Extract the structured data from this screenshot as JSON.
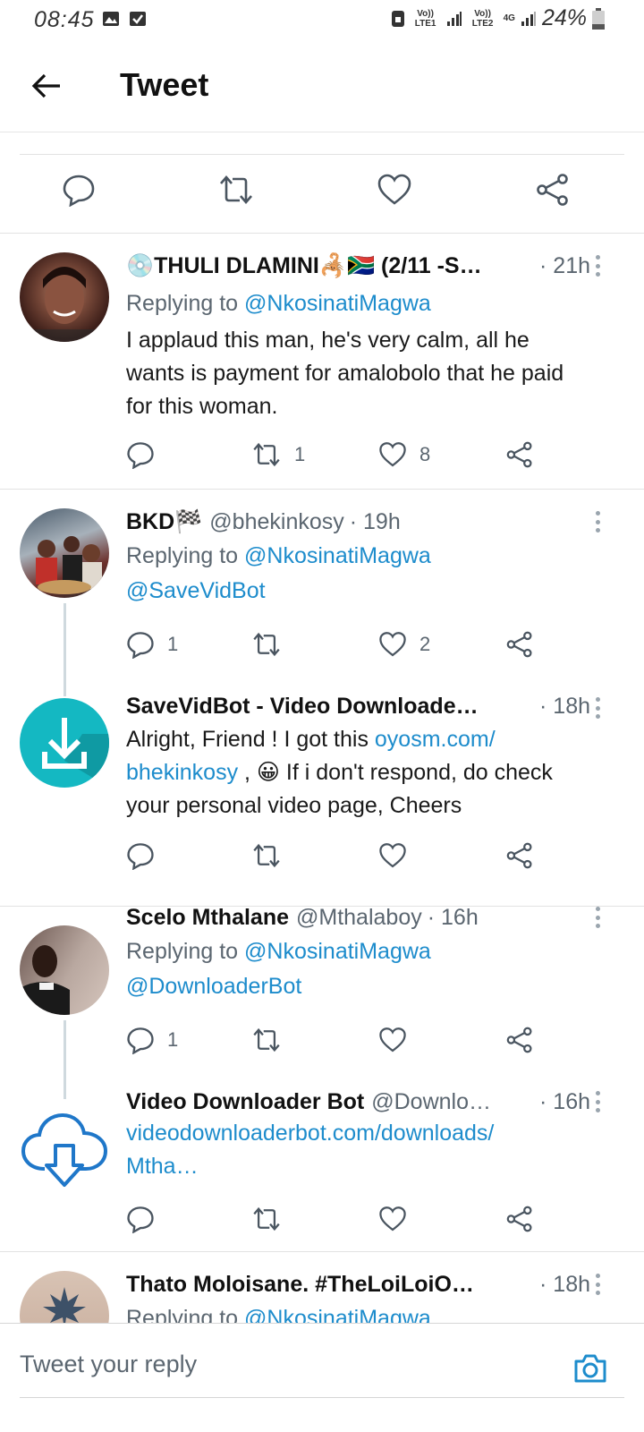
{
  "status_bar": {
    "time": "08:45",
    "sim1": "Vo)) LTE1",
    "sim2": "Vo)) LTE2",
    "network": "4G",
    "battery": "24%",
    "icons": [
      "image-icon",
      "check-icon",
      "lock-icon",
      "signal-icon",
      "battery-icon"
    ]
  },
  "header": {
    "title": "Tweet",
    "back_icon": "arrow-left-icon"
  },
  "colors": {
    "link": "#1d8ccc",
    "secondary_text": "#5b6670",
    "divider": "#e2e2e2",
    "thread_line": "#cfd9de"
  },
  "tweets": [
    {
      "name": "💿THULI DLAMINI🦂🇿🇦 (2/11 -S…",
      "handle": "",
      "time": "· 21h",
      "replying_prefix": "Replying to",
      "replying_to": "@NkosinatiMagwa",
      "text": "I applaud this man, he's very calm, all he wants is payment for amalobolo that he paid for this woman.",
      "replies": "",
      "retweets": "1",
      "likes": "8"
    },
    {
      "name": "BKD🏁",
      "handle": "@bhekinkosy",
      "time": "· 19h",
      "replying_prefix": "Replying to",
      "replying_to": "@NkosinatiMagwa",
      "mention": "@SaveVidBot",
      "replies": "1",
      "retweets": "",
      "likes": "2"
    },
    {
      "name": "SaveVidBot - Video Downloade…",
      "handle": "",
      "time": "· 18h",
      "text_a": "Alright, Friend ! I got this ",
      "link_a": "oyosm.com/",
      "link_b": "bhekinkosy",
      "text_b": " ,  😀 If i don't respond, do check your personal video page, Cheers",
      "replies": "",
      "retweets": "",
      "likes": ""
    },
    {
      "name": "Scelo Mthalane",
      "handle": "@Mthalaboy",
      "time": "· 16h",
      "replying_prefix": "Replying to",
      "replying_to": "@NkosinatiMagwa",
      "mention": "@DownloaderBot",
      "replies": "1",
      "retweets": "",
      "likes": ""
    },
    {
      "name": "Video Downloader Bot",
      "handle": "@Downlo…",
      "time": "· 16h",
      "link_a": "videodownloaderbot.com/downloads/",
      "link_b": "Mtha…",
      "replies": "",
      "retweets": "",
      "likes": ""
    },
    {
      "name": "Thato Moloisane. #TheLoiLoiO…",
      "handle": "",
      "time": "· 18h",
      "replying_prefix": "Replying to",
      "replying_to": "@NkosinatiMagwa"
    }
  ],
  "composer": {
    "placeholder": "Tweet your reply",
    "camera_icon": "camera-icon"
  }
}
